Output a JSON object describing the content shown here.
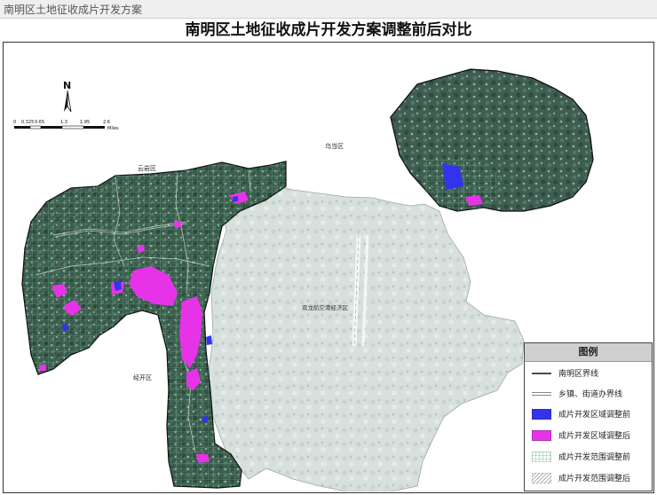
{
  "header": {
    "caption": "南明区土地征收成片开发方案"
  },
  "map": {
    "title": "南明区土地征收成片开发方案调整前后对比",
    "north_label": "N",
    "scale": {
      "ticks": [
        "0",
        "0.325",
        "0.65",
        "1.3",
        "1.95",
        "2.6"
      ],
      "unit": "Miles"
    },
    "place_labels": {
      "yunyan": "云岩区",
      "wudang": "乌当区",
      "jingkai": "经开区",
      "shuanglong": "双龙航空港经济区"
    }
  },
  "legend": {
    "title": "图例",
    "items": [
      {
        "label": "南明区界线",
        "symbol": "solid-line"
      },
      {
        "label": "乡镇、街道办界线",
        "symbol": "double-line"
      },
      {
        "label": "成片开发区域调整前",
        "symbol": "fill",
        "color": "#3333ee"
      },
      {
        "label": "成片开发区域调整后",
        "symbol": "fill",
        "color": "#e733e7"
      },
      {
        "label": "成片开发范围调整前",
        "symbol": "grid-hatch",
        "color": "#5ec27a"
      },
      {
        "label": "成片开发范围调整后",
        "symbol": "diagonal-hatch",
        "color": "#555555"
      }
    ]
  }
}
